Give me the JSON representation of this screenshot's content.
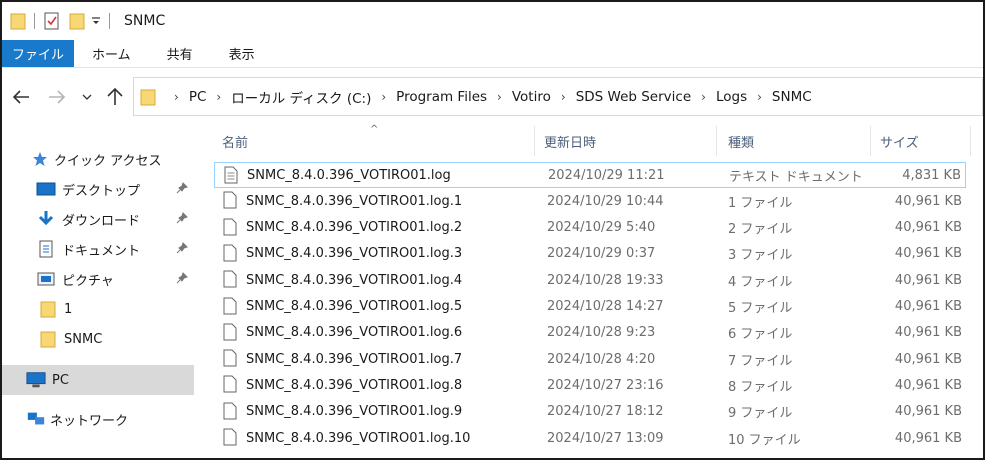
{
  "window": {
    "title": "SNMC"
  },
  "ribbon": {
    "tabs": [
      "ファイル",
      "ホーム",
      "共有",
      "表示"
    ]
  },
  "address": {
    "crumbs": [
      "PC",
      "ローカル ディスク (C:)",
      "Program Files",
      "Votiro",
      "SDS Web Service",
      "Logs",
      "SNMC"
    ]
  },
  "nav": {
    "quick_access": "クイック アクセス",
    "items": [
      {
        "label": "デスクトップ",
        "icon": "desktop-icon",
        "pinned": true
      },
      {
        "label": "ダウンロード",
        "icon": "download-icon",
        "pinned": true
      },
      {
        "label": "ドキュメント",
        "icon": "documents-icon",
        "pinned": true
      },
      {
        "label": "ピクチャ",
        "icon": "pictures-icon",
        "pinned": true
      },
      {
        "label": "1",
        "icon": "folder-icon",
        "pinned": false
      },
      {
        "label": "SNMC",
        "icon": "folder-icon",
        "pinned": false
      }
    ],
    "pc": "PC",
    "network": "ネットワーク"
  },
  "columns": {
    "name": "名前",
    "date": "更新日時",
    "type": "種類",
    "size": "サイズ"
  },
  "files": [
    {
      "name": "SNMC_8.4.0.396_VOTIRO01.log",
      "date": "2024/10/29 11:21",
      "type": "テキスト ドキュメント",
      "size": "4,831 KB",
      "selected": true
    },
    {
      "name": "SNMC_8.4.0.396_VOTIRO01.log.1",
      "date": "2024/10/29 10:44",
      "type": "1 ファイル",
      "size": "40,961 KB"
    },
    {
      "name": "SNMC_8.4.0.396_VOTIRO01.log.2",
      "date": "2024/10/29 5:40",
      "type": "2 ファイル",
      "size": "40,961 KB"
    },
    {
      "name": "SNMC_8.4.0.396_VOTIRO01.log.3",
      "date": "2024/10/29 0:37",
      "type": "3 ファイル",
      "size": "40,961 KB"
    },
    {
      "name": "SNMC_8.4.0.396_VOTIRO01.log.4",
      "date": "2024/10/28 19:33",
      "type": "4 ファイル",
      "size": "40,961 KB"
    },
    {
      "name": "SNMC_8.4.0.396_VOTIRO01.log.5",
      "date": "2024/10/28 14:27",
      "type": "5 ファイル",
      "size": "40,961 KB"
    },
    {
      "name": "SNMC_8.4.0.396_VOTIRO01.log.6",
      "date": "2024/10/28 9:23",
      "type": "6 ファイル",
      "size": "40,961 KB"
    },
    {
      "name": "SNMC_8.4.0.396_VOTIRO01.log.7",
      "date": "2024/10/28 4:20",
      "type": "7 ファイル",
      "size": "40,961 KB"
    },
    {
      "name": "SNMC_8.4.0.396_VOTIRO01.log.8",
      "date": "2024/10/27 23:16",
      "type": "8 ファイル",
      "size": "40,961 KB"
    },
    {
      "name": "SNMC_8.4.0.396_VOTIRO01.log.9",
      "date": "2024/10/27 18:12",
      "type": "9 ファイル",
      "size": "40,961 KB"
    },
    {
      "name": "SNMC_8.4.0.396_VOTIRO01.log.10",
      "date": "2024/10/27 13:09",
      "type": "10 ファイル",
      "size": "40,961 KB"
    }
  ],
  "colors": {
    "file_tab": "#1979ca",
    "folder": "#f8d775",
    "selection": "#99d1ff"
  }
}
